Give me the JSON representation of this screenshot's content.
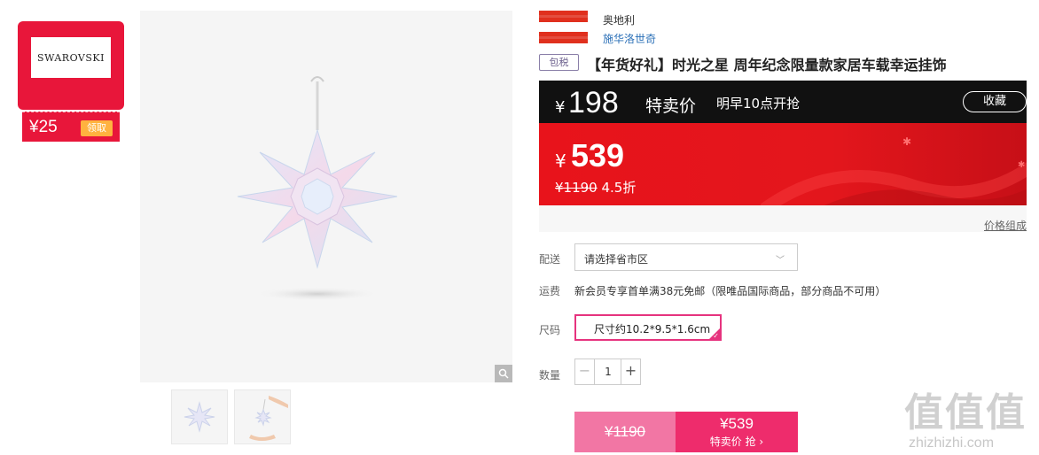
{
  "brand_card": {
    "logo_text": "SWAROVSKI",
    "coupon_price": "¥25",
    "coupon_button": "领取"
  },
  "gallery": {
    "main_image": "crystal-star-ornament",
    "zoom_icon": "magnifier-icon",
    "thumbnails": [
      "crystal-star-ornament",
      "hand-holding-ornament"
    ]
  },
  "origin": {
    "country": "奥地利",
    "brand": "施华洛世奇"
  },
  "product": {
    "tax_tag": "包税",
    "title": "【年货好礼】时光之星 周年纪念限量款家居车载幸运挂饰"
  },
  "promo": {
    "currency": "¥",
    "flash_price": "198",
    "flash_label": "特卖价",
    "start_time": "明早10点开抢",
    "favorite_button": "收藏",
    "current_price": "539",
    "original_price": "¥1190",
    "discount": "4.5折",
    "price_breakdown_link": "价格组成"
  },
  "options": {
    "delivery_label": "配送",
    "region_placeholder": "请选择省市区",
    "shipping_label": "运费",
    "shipping_text": "新会员专享首单满38元免邮（限唯品国际商品，部分商品不可用）",
    "size_label": "尺码",
    "size_value": "尺寸约10.2*9.5*1.6cm",
    "quantity_label": "数量",
    "quantity_value": "1",
    "minus": "−",
    "plus": "+"
  },
  "buy": {
    "original_price": "¥1190",
    "price": "¥539",
    "action": "特卖价 抢 ›"
  },
  "watermark": {
    "big": "值值值",
    "small": "zhizhizhi.com"
  },
  "colors": {
    "brand_red": "#e8163a",
    "promo_red": "#e3161c",
    "accent_pink": "#ee2c6c",
    "light_pink": "#f276a4",
    "coupon_orange": "#ffb23f",
    "link_blue": "#2a6fb7"
  }
}
